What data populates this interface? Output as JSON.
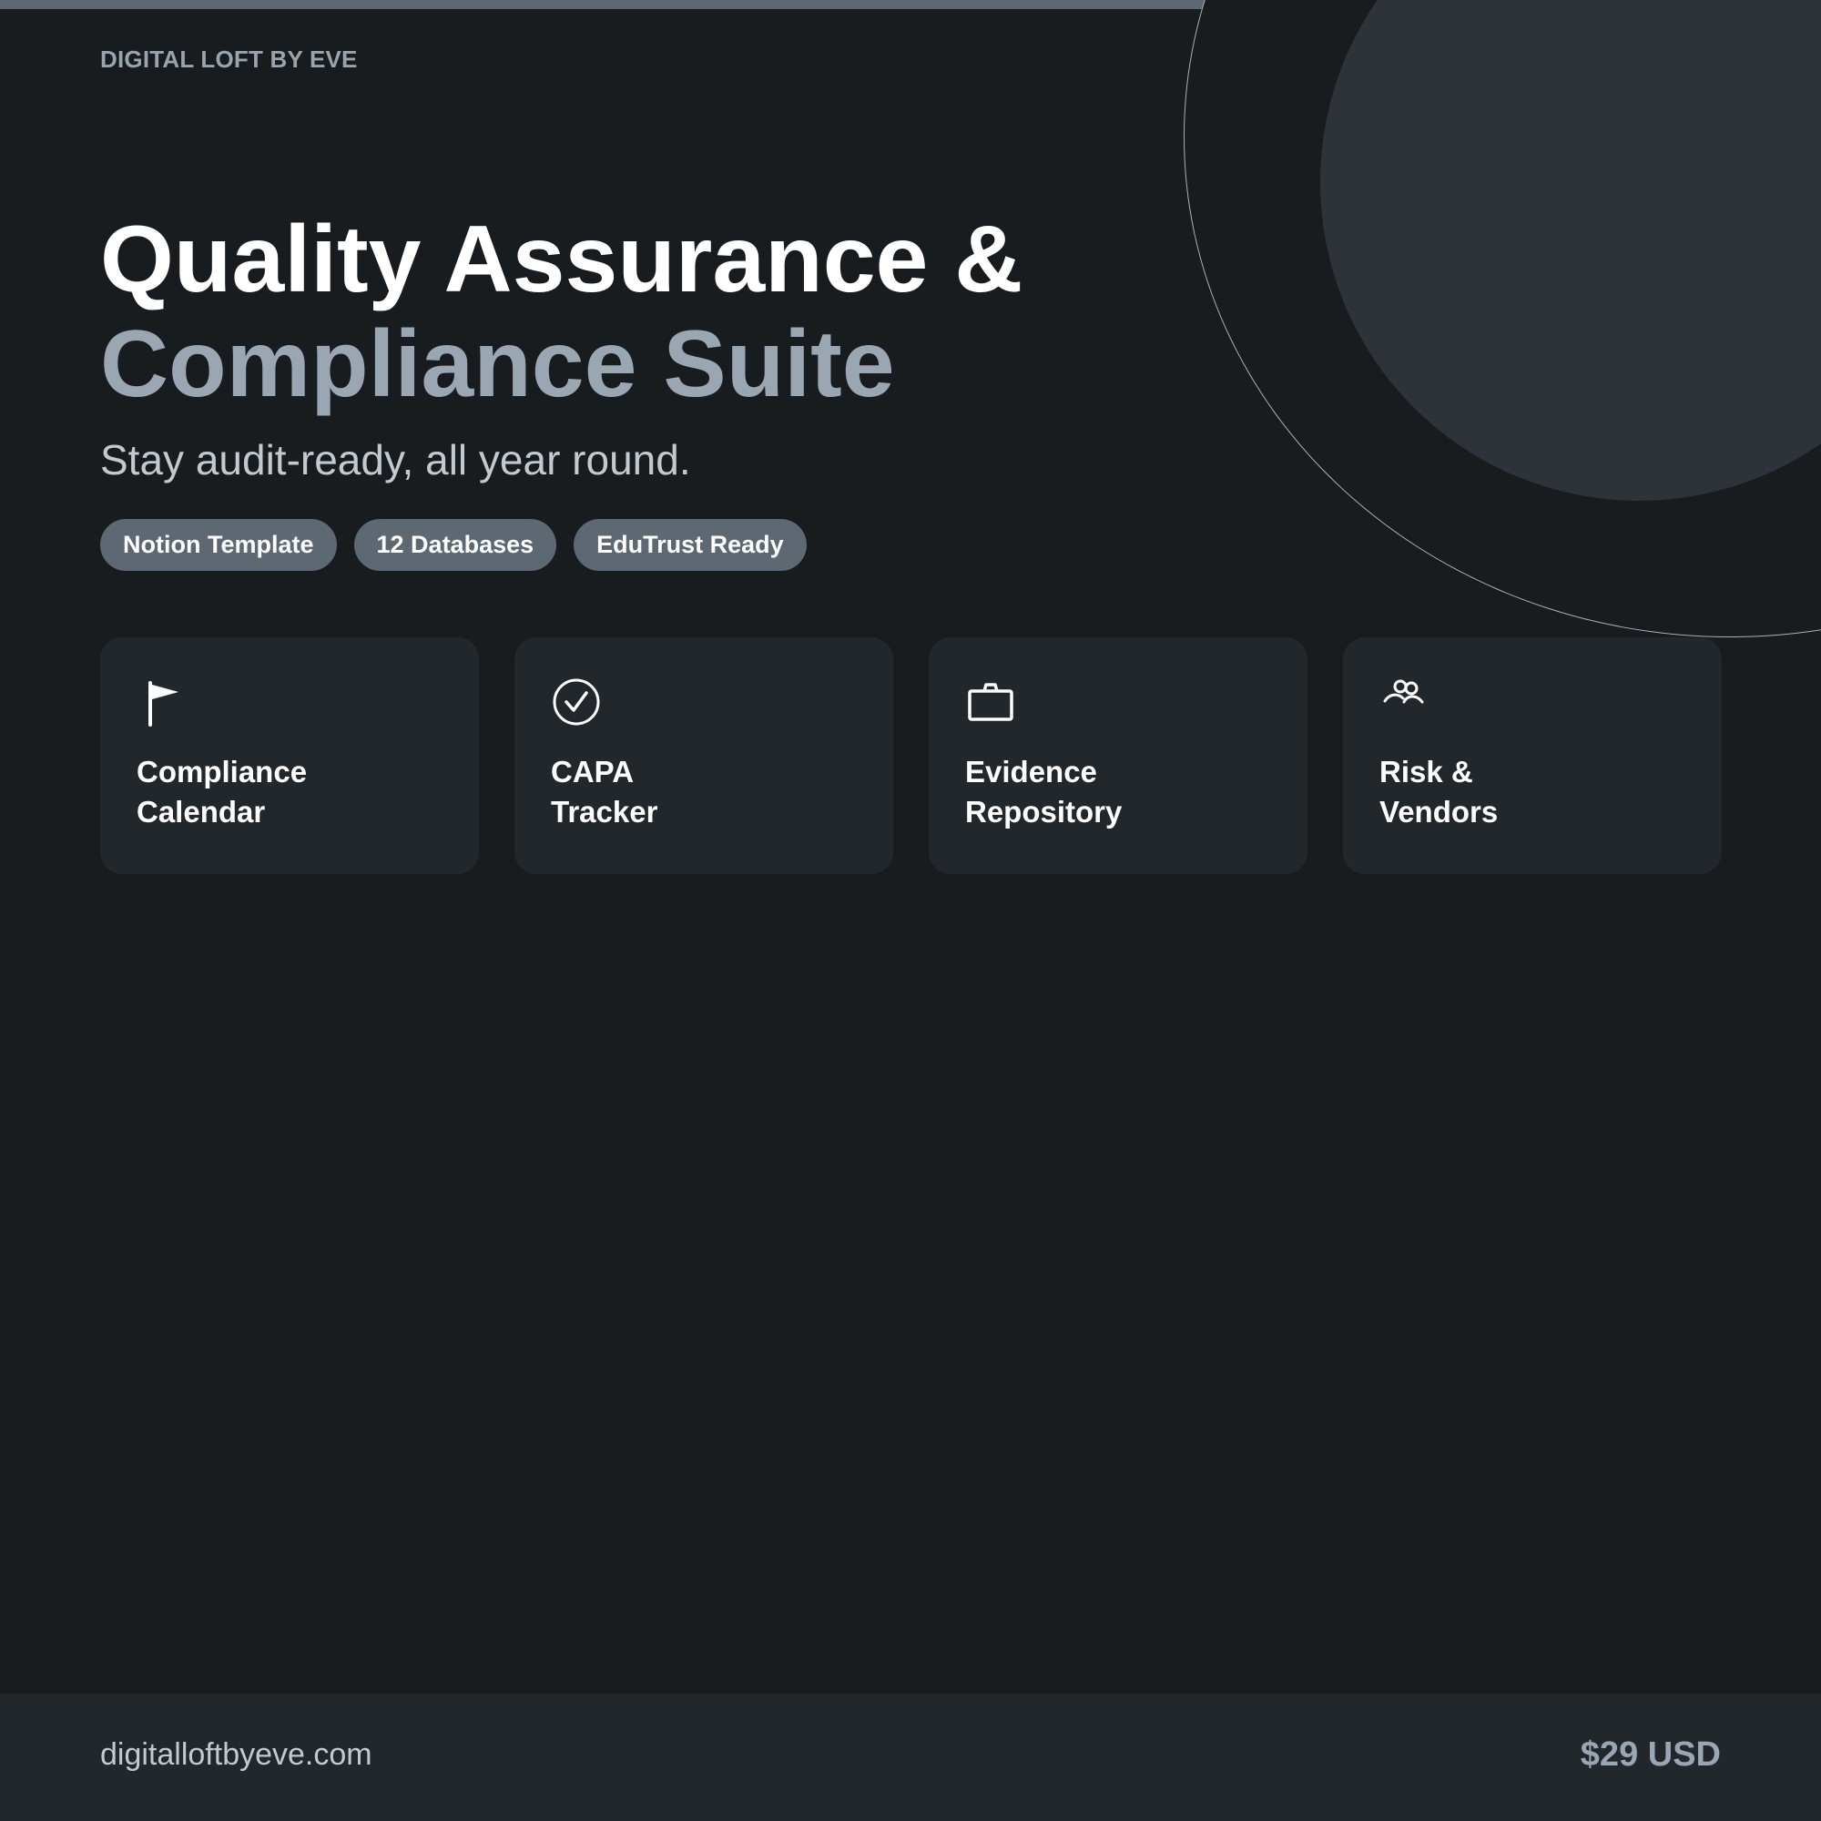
{
  "brand": "DIGITAL LOFT BY EVE",
  "hero": {
    "title_line1": "Quality Assurance &",
    "title_line2": "Compliance Suite",
    "subtitle": "Stay audit-ready, all year round."
  },
  "tags": [
    "Notion Template",
    "12 Databases",
    "EduTrust Ready"
  ],
  "cards": [
    {
      "icon": "flag-icon",
      "line1": "Compliance",
      "line2": "Calendar"
    },
    {
      "icon": "check-circle-icon",
      "line1": "CAPA",
      "line2": "Tracker"
    },
    {
      "icon": "briefcase-icon",
      "line1": "Evidence",
      "line2": "Repository"
    },
    {
      "icon": "people-icon",
      "line1": "Risk &",
      "line2": "Vendors"
    }
  ],
  "footer": {
    "website": "digitalloftbyeve.com",
    "price": "$29 USD"
  },
  "colors": {
    "background": "#181c1f",
    "card": "#22272c",
    "accent": "#5d6873",
    "muted_text": "#9aa7b2",
    "disc": "#2d3339"
  }
}
